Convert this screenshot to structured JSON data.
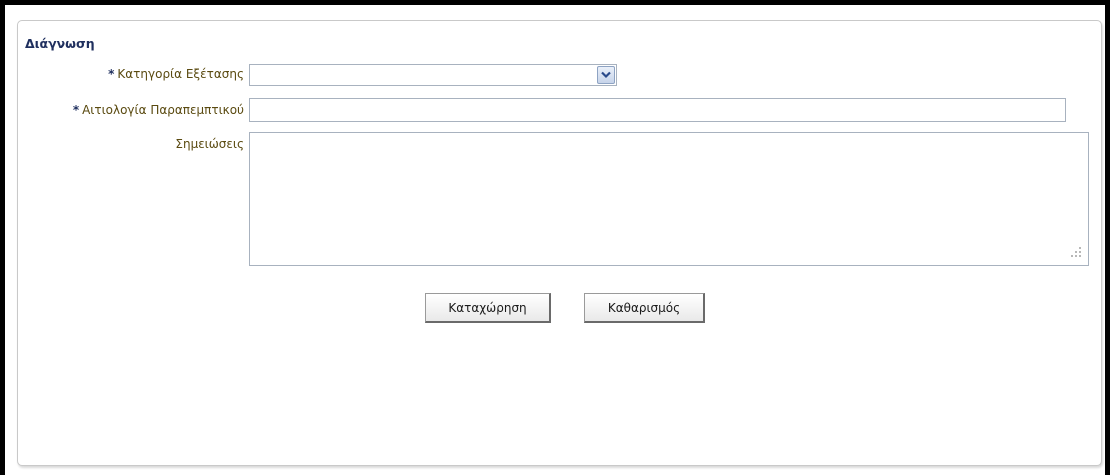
{
  "panel": {
    "title": "Διάγνωση"
  },
  "form": {
    "required_mark": "*",
    "exam_category": {
      "label": "Κατηγορία Εξέτασης",
      "value": "",
      "icon": "chevron-down-icon"
    },
    "referral_reason": {
      "label": "Αιτιολογία Παραπεμπτικού",
      "value": ""
    },
    "notes": {
      "label": "Σημειώσεις",
      "value": ""
    }
  },
  "buttons": {
    "save_label": "Καταχώρηση",
    "clear_label": "Καθαρισμός"
  },
  "colors": {
    "title": "#1f2f5e",
    "label": "#5a4a10",
    "input_border": "#a8b2bf"
  }
}
